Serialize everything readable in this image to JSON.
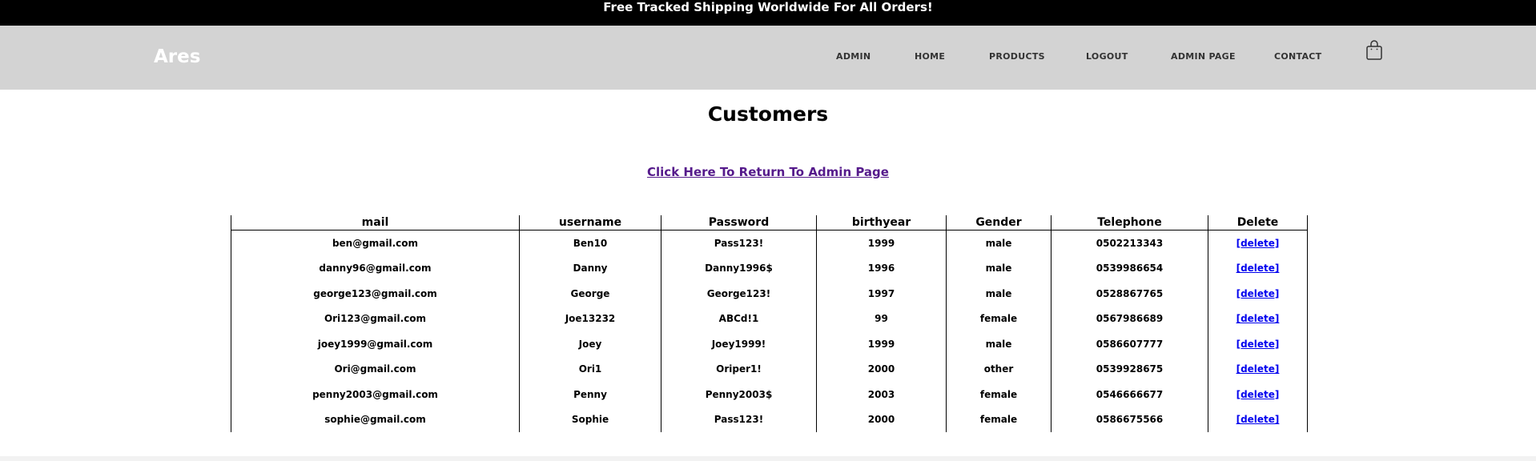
{
  "announcement": "Free Tracked Shipping Worldwide For All Orders!",
  "brand": "Ares",
  "nav": [
    {
      "label": "ADMIN"
    },
    {
      "label": "HOME"
    },
    {
      "label": "PRODUCTS"
    },
    {
      "label": "LOGOUT"
    },
    {
      "label": "ADMIN PAGE"
    },
    {
      "label": "CONTACT"
    }
  ],
  "cart_icon": "shopping-bag-icon",
  "page_title": "Customers",
  "return_link": "Click Here To Return To Admin Page",
  "table": {
    "headers": [
      "mail",
      "username",
      "Password",
      "birthyear",
      "Gender",
      "Telephone",
      "Delete"
    ],
    "rows": [
      [
        "ben@gmail.com",
        "Ben10",
        "Pass123!",
        "1999",
        "male",
        "0502213343",
        "[delete]"
      ],
      [
        "danny96@gmail.com",
        "Danny",
        "Danny1996$",
        "1996",
        "male",
        "0539986654",
        "[delete]"
      ],
      [
        "george123@gmail.com",
        "George",
        "George123!",
        "1997",
        "male",
        "0528867765",
        "[delete]"
      ],
      [
        "Ori123@gmail.com",
        "Joe13232",
        "ABCd!1",
        "99",
        "female",
        "0567986689",
        "[delete]"
      ],
      [
        "joey1999@gmail.com",
        "Joey",
        "Joey1999!",
        "1999",
        "male",
        "0586607777",
        "[delete]"
      ],
      [
        "Ori@gmail.com",
        "Ori1",
        "Oriper1!",
        "2000",
        "other",
        "0539928675",
        "[delete]"
      ],
      [
        "penny2003@gmail.com",
        "Penny",
        "Penny2003$",
        "2003",
        "female",
        "0546666677",
        "[delete]"
      ],
      [
        "sophie@gmail.com",
        "Sophie",
        "Pass123!",
        "2000",
        "female",
        "0586675566",
        "[delete]"
      ]
    ]
  }
}
